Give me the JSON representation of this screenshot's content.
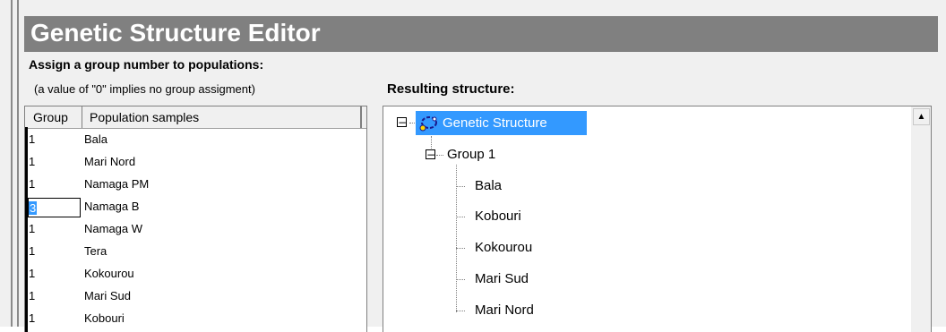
{
  "window": {
    "title": "Genetic Structure Editor"
  },
  "left_panel": {
    "heading": "Assign a group number to populations:",
    "note": "(a value of \"0\" implies no group assigment)",
    "columns": [
      "Group",
      "Population samples"
    ],
    "rows": [
      {
        "group": "1",
        "population": "Bala"
      },
      {
        "group": "1",
        "population": "Mari Nord"
      },
      {
        "group": "1",
        "population": "Namaga PM"
      },
      {
        "group": "3",
        "population": "Namaga B",
        "editing": true
      },
      {
        "group": "1",
        "population": "Namaga W"
      },
      {
        "group": "1",
        "population": "Tera"
      },
      {
        "group": "1",
        "population": "Kokourou"
      },
      {
        "group": "1",
        "population": "Mari Sud"
      },
      {
        "group": "1",
        "population": "Kobouri"
      }
    ]
  },
  "right_panel": {
    "heading": "Resulting structure:",
    "tree": {
      "root": "Genetic Structure",
      "groups": [
        {
          "label": "Group 1",
          "children": [
            "Bala",
            "Kobouri",
            "Kokourou",
            "Mari Sud",
            "Mari Nord"
          ]
        }
      ]
    }
  },
  "colors": {
    "title_bar": "#808080",
    "selection": "#3399ff",
    "background": "#f0f0f0"
  },
  "icons": {
    "root": "genetic-structure-icon",
    "expander": "minus-box-icon",
    "scroll_up": "arrow-up-icon"
  }
}
